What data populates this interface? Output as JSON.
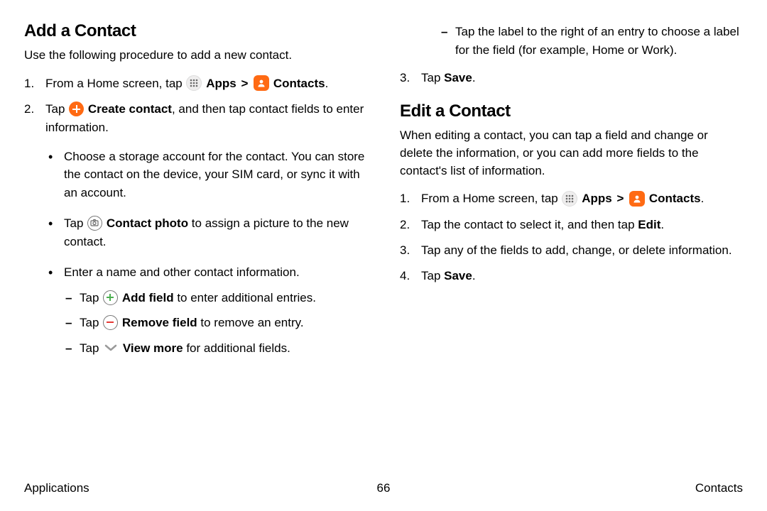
{
  "col1": {
    "title": "Add a Contact",
    "intro": "Use the following procedure to add a new contact.",
    "step1": {
      "pre": "From a Home screen, tap ",
      "apps": "Apps",
      "contacts": "Contacts",
      "end": "."
    },
    "step2": {
      "pre": "Tap ",
      "create": "Create contact",
      "post": ", and then tap contact fields to enter information."
    },
    "b1": "Choose a storage account for the contact. You can store the contact on the device, your SIM card, or sync it with an account.",
    "b2": {
      "pre": "Tap ",
      "label": "Contact photo",
      "post": " to assign a picture to the new contact."
    },
    "b3": "Enter a name and other contact information.",
    "d1": {
      "pre": "Tap ",
      "label": "Add field",
      "post": " to enter additional entries."
    },
    "d2": {
      "pre": "Tap ",
      "label": "Remove field",
      "post": " to remove an entry."
    },
    "d3": {
      "pre": "Tap ",
      "label": "View more",
      "post": " for additional fields."
    }
  },
  "col2": {
    "topdash": "Tap the label to the right of an entry to choose a label for the field (for example, Home or Work).",
    "step3": {
      "pre": "Tap ",
      "save": "Save",
      "end": "."
    },
    "title": "Edit a Contact",
    "intro": "When editing a contact, you can tap a field and change or delete the information, or you can add more fields to the contact's list of information.",
    "s1": {
      "pre": "From a Home screen, tap ",
      "apps": "Apps",
      "contacts": "Contacts",
      "end": "."
    },
    "s2": {
      "pre": "Tap the contact to select it, and then tap ",
      "edit": "Edit",
      "end": "."
    },
    "s3": "Tap any of the fields to add, change, or delete information.",
    "s4": {
      "pre": "Tap ",
      "save": "Save",
      "end": "."
    }
  },
  "footer": {
    "left": "Applications",
    "page": "66",
    "right": "Contacts"
  },
  "chev": ">"
}
